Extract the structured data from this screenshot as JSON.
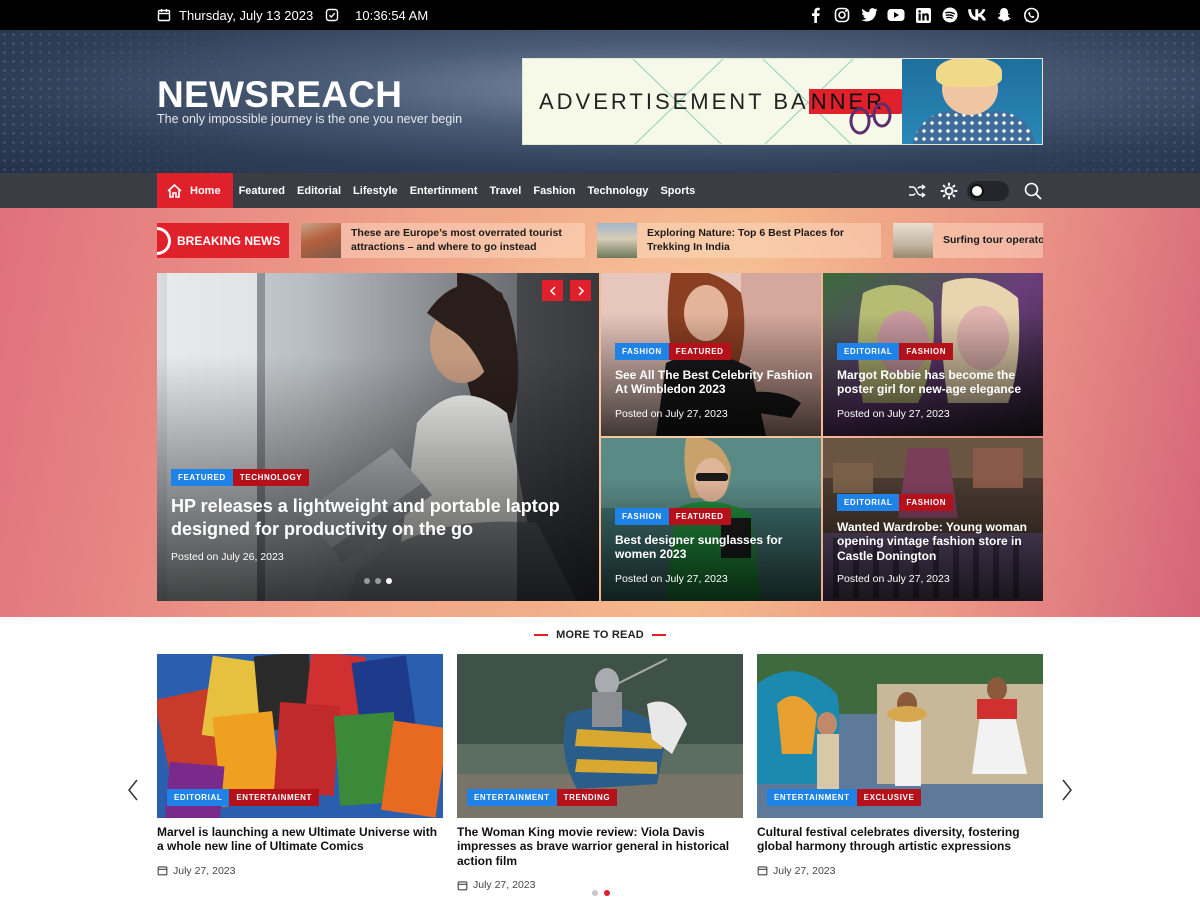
{
  "topbar": {
    "date": "Thursday, July 13 2023",
    "time": "10:36:54 AM",
    "social": [
      "facebook-icon",
      "instagram-icon",
      "twitter-icon",
      "youtube-icon",
      "linkedin-icon",
      "spotify-icon",
      "vk-icon",
      "snapchat-icon",
      "whatsapp-icon"
    ]
  },
  "header": {
    "logo": "NEWSREACH",
    "tagline": "The only impossible journey is the one you never begin",
    "ad_text_a": "ADVERTISEMENT BA",
    "ad_text_b": "NNER"
  },
  "nav": {
    "items": [
      "Home",
      "Featured",
      "Editorial",
      "Lifestyle",
      "Entertinment",
      "Travel",
      "Fashion",
      "Technology",
      "Sports"
    ]
  },
  "breaking": {
    "label": "BREAKING NEWS",
    "items": [
      "These are Europe’s most overrated tourist attractions – and where to go instead",
      "Exploring Nature: Top 6 Best Places for Trekking In India",
      "Surfing tour operator b pumping surf trips to"
    ]
  },
  "featured": {
    "main": {
      "tags": [
        "FEATURED",
        "TECHNOLOGY"
      ],
      "title": "HP releases a lightweight and portable laptop designed for productivity on the go",
      "date": "Posted on July 26, 2023"
    },
    "cards": [
      {
        "tags": [
          "FASHION",
          "FEATURED"
        ],
        "title": "See All The Best Celebrity Fashion At Wimbledon 2023",
        "date": "Posted on July 27, 2023"
      },
      {
        "tags": [
          "EDITORIAL",
          "FASHION"
        ],
        "title": "Margot Robbie has become the poster girl for new-age elegance",
        "date": "Posted on July 27, 2023"
      },
      {
        "tags": [
          "FASHION",
          "FEATURED"
        ],
        "title": "Best designer sunglasses for women 2023",
        "date": "Posted on July 27, 2023"
      },
      {
        "tags": [
          "EDITORIAL",
          "FASHION"
        ],
        "title": "Wanted Wardrobe: Young woman opening vintage fashion store in Castle Donington",
        "date": "Posted on July 27, 2023"
      }
    ]
  },
  "more": {
    "title": "MORE TO READ",
    "posts": [
      {
        "tags": [
          "EDITORIAL",
          "ENTERTAINMENT"
        ],
        "title": "Marvel is launching a new Ultimate Universe with a whole new line of Ultimate Comics",
        "date": "July 27, 2023"
      },
      {
        "tags": [
          "ENTERTAINMENT",
          "TRENDING"
        ],
        "title": "The Woman King movie review: Viola Davis impresses as brave warrior general in historical action film",
        "date": "July 27, 2023"
      },
      {
        "tags": [
          "ENTERTAINMENT",
          "EXCLUSIVE"
        ],
        "title": "Cultural festival celebrates diversity, fostering global harmony through artistic expressions",
        "date": "July 27, 2023"
      }
    ]
  },
  "colors": {
    "accent": "#e0202a",
    "tag_blue": "#1e82e6",
    "tag_red": "#b4111b",
    "nav_bg": "#3b3d44"
  }
}
